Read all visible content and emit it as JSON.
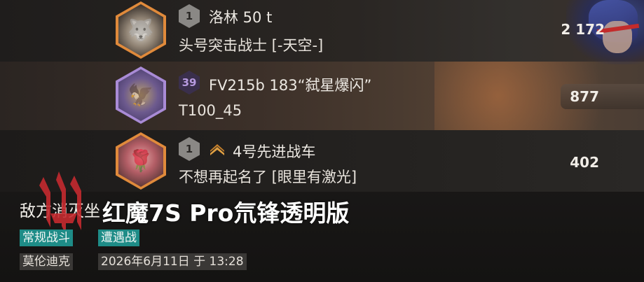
{
  "players": [
    {
      "level": "1",
      "tank": "洛林 50 t",
      "name": "头号突击战士 [-天空-]",
      "score": "2 172",
      "avatar_icon": "wolf-avatar-icon"
    },
    {
      "level": "39",
      "tank": "FV215b 183“弑星爆闪”",
      "name": "T100_45",
      "score": "877",
      "avatar_icon": "golden-eagle-avatar-icon"
    },
    {
      "level": "1",
      "tank": "4号先进战车",
      "name": "不想再起名了 [眼里有激光]",
      "score": "402",
      "avatar_icon": "rose-avatar-icon",
      "rank_icon": "chevron-rank-icon"
    }
  ],
  "header": {
    "title": "敌方消灭坐",
    "watermark": "红魔7S Pro氘锋透明版"
  },
  "tags": [
    "常规战斗",
    "遭遇战"
  ],
  "info": {
    "map": "莫伦迪克",
    "datetime": "2026年6月11日 于 13:28"
  },
  "colors": {
    "teal_tag": "#1e8c87",
    "orange_frame": "#e08a3b",
    "purple_frame": "#a98bd6"
  }
}
